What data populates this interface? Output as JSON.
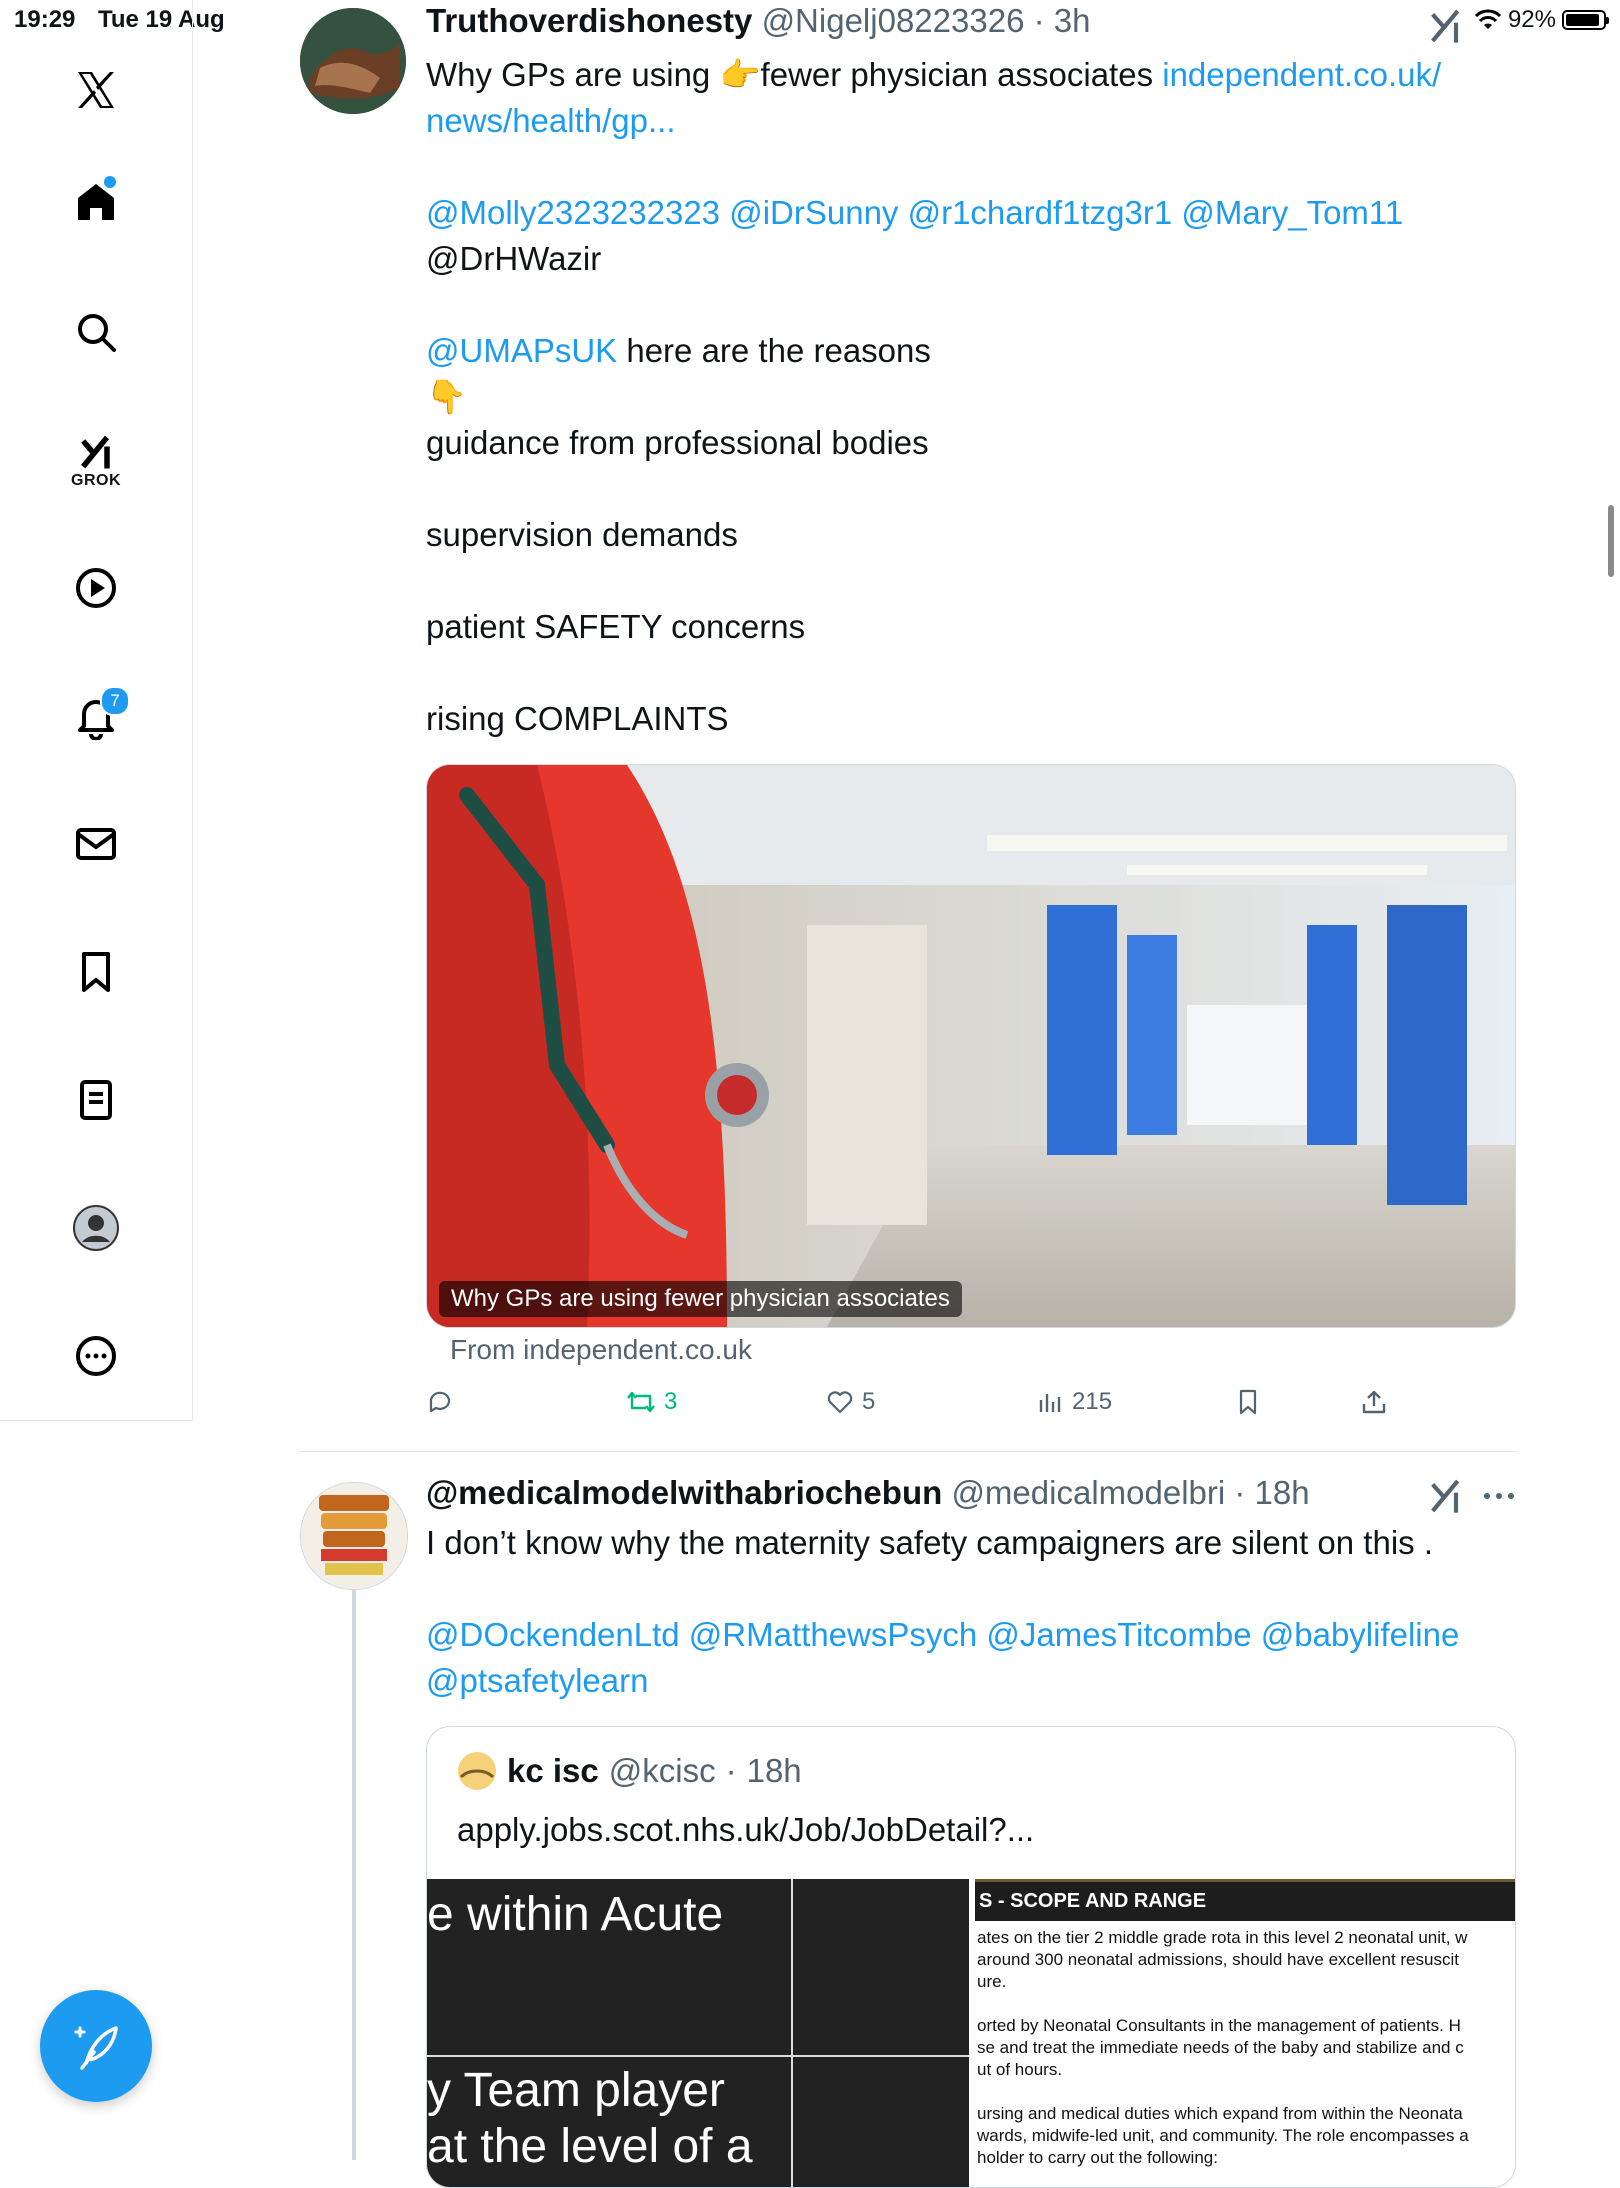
{
  "status": {
    "time": "19:29",
    "date": "Tue 19 Aug",
    "battery": "92%",
    "battery_level": 0.92
  },
  "sidebar": {
    "items": [
      {
        "name": "x-logo"
      },
      {
        "name": "home",
        "has_dot": true
      },
      {
        "name": "search"
      },
      {
        "name": "grok",
        "label": "GROK"
      },
      {
        "name": "video"
      },
      {
        "name": "notifications",
        "badge": "7"
      },
      {
        "name": "messages"
      },
      {
        "name": "bookmarks"
      },
      {
        "name": "lists"
      },
      {
        "name": "profile"
      },
      {
        "name": "more"
      }
    ]
  },
  "tweet1": {
    "display_name": "Truthoverdishonesty",
    "handle": "@Nigelj08223326",
    "time": "3h",
    "line1_pre": "Why GPs are using ",
    "emoji_point_right": "👉",
    "line1_post": "fewer physician associates ",
    "link1": "independent.co.uk/",
    "link2": "news/health/gp...",
    "mentions_line": "@Molly2323232323 @iDrSunny @r1chardf1tzg3r1 @Mary_Tom11",
    "mention_plain": "@DrHWazir",
    "mention_umaps": "@UMAPsUK",
    "reasons_text": " here are the reasons",
    "emoji_point_down": "👇",
    "reason1": "guidance from professional bodies",
    "reason2": "supervision demands",
    "reason3": "patient SAFETY concerns",
    "reason4": "rising COMPLAINTS",
    "card_caption": "Why GPs are using fewer physician associates",
    "card_from": "From independent.co.uk",
    "retweets": "3",
    "likes": "5",
    "views": "215"
  },
  "tweet2": {
    "display_name": "@medicalmodelwithabriochebun",
    "handle": "@medicalmodelbri",
    "time": "18h",
    "text": "I don’t know why the maternity safety campaigners are silent on this .",
    "mentions_line1": "@DOckendenLtd @RMatthewsPsych @JamesTitcombe @babylifeline",
    "mentions_line2": "@ptsafetylearn",
    "quote": {
      "display_name": "kc isc",
      "handle": "@kcisc",
      "time": "18h",
      "url": "apply.jobs.scot.nhs.uk/Job/JobDetail?...",
      "img_left_line1": "e within Acute",
      "img_left_line2": "y Team player",
      "img_left_line3": "at the level of a",
      "img_right_title": "S - SCOPE AND RANGE",
      "img_right_p1a": "ates on the tier 2 middle grade rota in this level 2 neonatal unit, w",
      "img_right_p1b": "around 300 neonatal admissions, should have excellent resuscit",
      "img_right_p1c": "ure.",
      "img_right_p2a": "orted by Neonatal Consultants in the management of patients. H",
      "img_right_p2b": "se and treat the immediate needs of the baby and stabilize and c",
      "img_right_p2c": "ut of hours.",
      "img_right_p3a": "ursing and medical duties which expand from within the Neonata",
      "img_right_p3b": "wards, midwife-led unit, and community. The role encompasses a",
      "img_right_p3c": "holder to carry out the following:"
    }
  }
}
